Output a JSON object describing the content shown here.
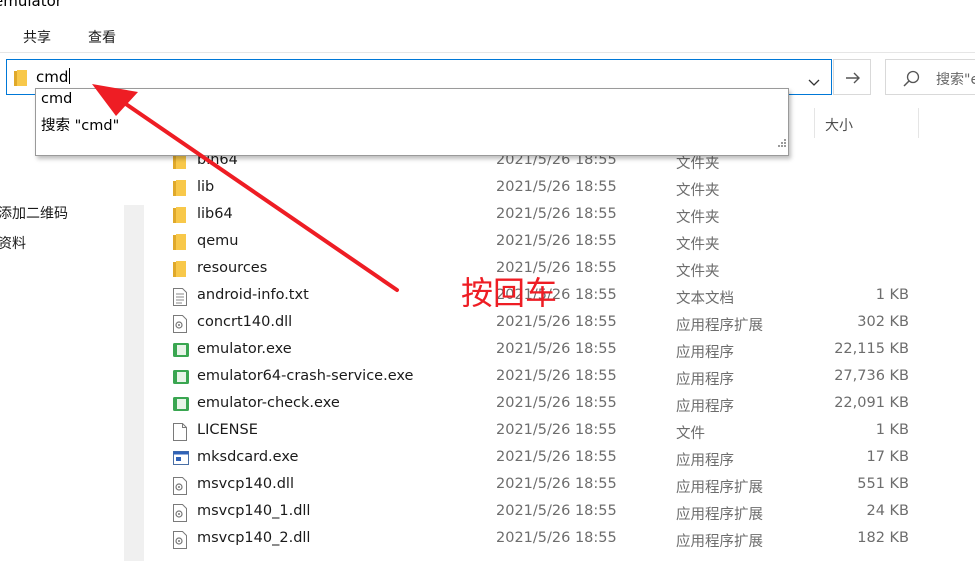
{
  "window": {
    "title": "emulator"
  },
  "ribbon": {
    "tabs": [
      "共享",
      "查看"
    ]
  },
  "address_bar": {
    "value": "cmd"
  },
  "search": {
    "placeholder": "搜索\"e"
  },
  "autocomplete": {
    "options": [
      "cmd",
      "搜索 \"cmd\""
    ]
  },
  "navigation": {
    "items": [
      "添加二维码",
      "资料"
    ]
  },
  "columns": {
    "size": "大小"
  },
  "files": [
    {
      "name": "bin64",
      "date": "2021/5/26 18:55",
      "type": "文件夹",
      "size": "",
      "icon": "folder-icon"
    },
    {
      "name": "lib",
      "date": "2021/5/26 18:55",
      "type": "文件夹",
      "size": "",
      "icon": "folder-icon"
    },
    {
      "name": "lib64",
      "date": "2021/5/26 18:55",
      "type": "文件夹",
      "size": "",
      "icon": "folder-icon"
    },
    {
      "name": "qemu",
      "date": "2021/5/26 18:55",
      "type": "文件夹",
      "size": "",
      "icon": "folder-icon"
    },
    {
      "name": "resources",
      "date": "2021/5/26 18:55",
      "type": "文件夹",
      "size": "",
      "icon": "folder-icon"
    },
    {
      "name": "android-info.txt",
      "date": "2021/5/26 18:55",
      "type": "文本文档",
      "size": "1 KB",
      "icon": "text-file-icon"
    },
    {
      "name": "concrt140.dll",
      "date": "2021/5/26 18:55",
      "type": "应用程序扩展",
      "size": "302 KB",
      "icon": "dll-file-icon"
    },
    {
      "name": "emulator.exe",
      "date": "2021/5/26 18:55",
      "type": "应用程序",
      "size": "22,115 KB",
      "icon": "android-exe-icon"
    },
    {
      "name": "emulator64-crash-service.exe",
      "date": "2021/5/26 18:55",
      "type": "应用程序",
      "size": "27,736 KB",
      "icon": "android-exe-icon"
    },
    {
      "name": "emulator-check.exe",
      "date": "2021/5/26 18:55",
      "type": "应用程序",
      "size": "22,091 KB",
      "icon": "android-exe-icon"
    },
    {
      "name": "LICENSE",
      "date": "2021/5/26 18:55",
      "type": "文件",
      "size": "1 KB",
      "icon": "blank-file-icon"
    },
    {
      "name": "mksdcard.exe",
      "date": "2021/5/26 18:55",
      "type": "应用程序",
      "size": "17 KB",
      "icon": "window-exe-icon"
    },
    {
      "name": "msvcp140.dll",
      "date": "2021/5/26 18:55",
      "type": "应用程序扩展",
      "size": "551 KB",
      "icon": "dll-file-icon"
    },
    {
      "name": "msvcp140_1.dll",
      "date": "2021/5/26 18:55",
      "type": "应用程序扩展",
      "size": "24 KB",
      "icon": "dll-file-icon"
    },
    {
      "name": "msvcp140_2.dll",
      "date": "2021/5/26 18:55",
      "type": "应用程序扩展",
      "size": "182 KB",
      "icon": "dll-file-icon"
    }
  ],
  "annotation": {
    "text": "按回车",
    "color": "#ee1d24"
  },
  "colors": {
    "accent": "#0078d7",
    "folder": "#f8c84a",
    "android_green": "#3aa651"
  }
}
